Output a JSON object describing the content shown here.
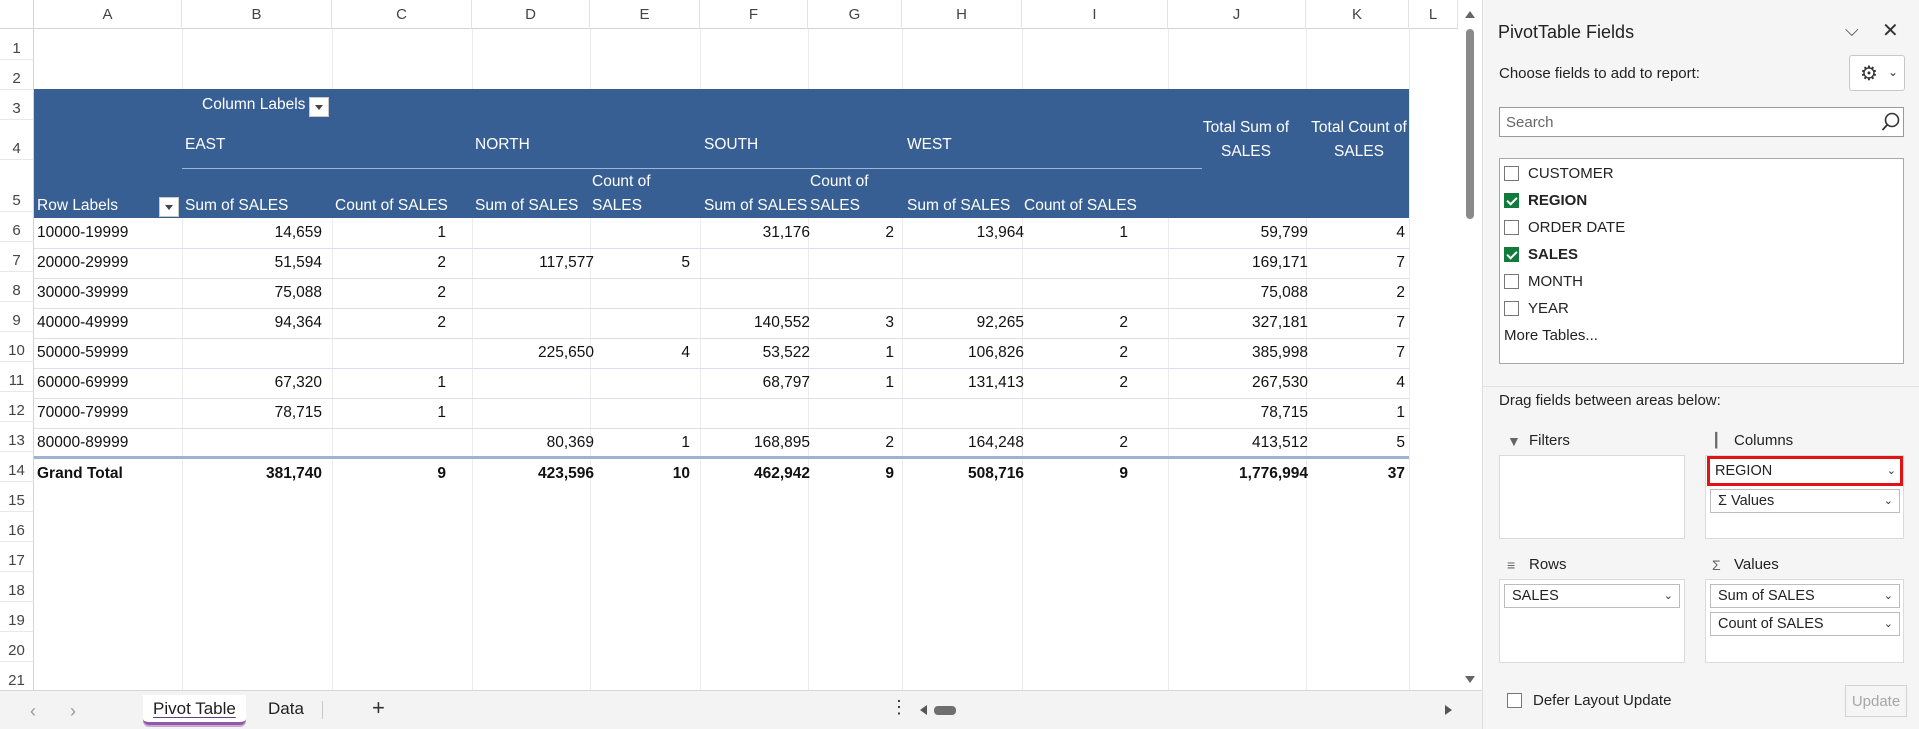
{
  "grid": {
    "columns": [
      "A",
      "B",
      "C",
      "D",
      "E",
      "F",
      "G",
      "H",
      "I",
      "J",
      "K",
      "L"
    ],
    "rows": [
      "1",
      "2",
      "3",
      "4",
      "5",
      "6",
      "7",
      "8",
      "9",
      "10",
      "11",
      "12",
      "13",
      "14",
      "15",
      "16",
      "17",
      "18",
      "19",
      "20",
      "21"
    ]
  },
  "pivot": {
    "column_labels": "Column Labels",
    "row_labels": "Row Labels",
    "regions": [
      "EAST",
      "NORTH",
      "SOUTH",
      "WEST"
    ],
    "sum_label": "Sum of SALES",
    "count_label": "Count of SALES",
    "count_wrapped_1": "Count of",
    "count_wrapped_2": "SALES",
    "total_sum_label": "Total Sum of SALES",
    "total_count_label": "Total Count of SALES",
    "data_rows": [
      {
        "label": "10000-19999",
        "east_sum": "14,659",
        "east_count": "1",
        "north_sum": "",
        "north_count": "",
        "south_sum": "31,176",
        "south_count": "2",
        "west_sum": "13,964",
        "west_count": "1",
        "total_sum": "59,799",
        "total_count": "4"
      },
      {
        "label": "20000-29999",
        "east_sum": "51,594",
        "east_count": "2",
        "north_sum": "117,577",
        "north_count": "5",
        "south_sum": "",
        "south_count": "",
        "west_sum": "",
        "west_count": "",
        "total_sum": "169,171",
        "total_count": "7"
      },
      {
        "label": "30000-39999",
        "east_sum": "75,088",
        "east_count": "2",
        "north_sum": "",
        "north_count": "",
        "south_sum": "",
        "south_count": "",
        "west_sum": "",
        "west_count": "",
        "total_sum": "75,088",
        "total_count": "2"
      },
      {
        "label": "40000-49999",
        "east_sum": "94,364",
        "east_count": "2",
        "north_sum": "",
        "north_count": "",
        "south_sum": "140,552",
        "south_count": "3",
        "west_sum": "92,265",
        "west_count": "2",
        "total_sum": "327,181",
        "total_count": "7"
      },
      {
        "label": "50000-59999",
        "east_sum": "",
        "east_count": "",
        "north_sum": "225,650",
        "north_count": "4",
        "south_sum": "53,522",
        "south_count": "1",
        "west_sum": "106,826",
        "west_count": "2",
        "total_sum": "385,998",
        "total_count": "7"
      },
      {
        "label": "60000-69999",
        "east_sum": "67,320",
        "east_count": "1",
        "north_sum": "",
        "north_count": "",
        "south_sum": "68,797",
        "south_count": "1",
        "west_sum": "131,413",
        "west_count": "2",
        "total_sum": "267,530",
        "total_count": "4"
      },
      {
        "label": "70000-79999",
        "east_sum": "78,715",
        "east_count": "1",
        "north_sum": "",
        "north_count": "",
        "south_sum": "",
        "south_count": "",
        "west_sum": "",
        "west_count": "",
        "total_sum": "78,715",
        "total_count": "1"
      },
      {
        "label": "80000-89999",
        "east_sum": "",
        "east_count": "",
        "north_sum": "80,369",
        "north_count": "1",
        "south_sum": "168,895",
        "south_count": "2",
        "west_sum": "164,248",
        "west_count": "2",
        "total_sum": "413,512",
        "total_count": "5"
      }
    ],
    "grand_total": {
      "label": "Grand Total",
      "east_sum": "381,740",
      "east_count": "9",
      "north_sum": "423,596",
      "north_count": "10",
      "south_sum": "462,942",
      "south_count": "9",
      "west_sum": "508,716",
      "west_count": "9",
      "total_sum": "1,776,994",
      "total_count": "37"
    }
  },
  "sheets": {
    "tabs": [
      "Pivot Table",
      "Data"
    ],
    "active": "Pivot Table"
  },
  "panel": {
    "title": "PivotTable Fields",
    "choose_label": "Choose fields to add to report:",
    "search_placeholder": "Search",
    "fields": [
      {
        "name": "CUSTOMER",
        "checked": false
      },
      {
        "name": "REGION",
        "checked": true
      },
      {
        "name": "ORDER DATE",
        "checked": false
      },
      {
        "name": "SALES",
        "checked": true
      },
      {
        "name": "MONTH",
        "checked": false
      },
      {
        "name": "YEAR",
        "checked": false
      }
    ],
    "more_tables": "More Tables...",
    "drag_label": "Drag fields between areas below:",
    "areas": {
      "filters": "Filters",
      "columns": "Columns",
      "rows": "Rows",
      "values": "Values"
    },
    "columns_items": [
      "REGION",
      "Σ Values"
    ],
    "rows_items": [
      "SALES"
    ],
    "values_items": [
      "Sum of SALES",
      "Count of SALES"
    ],
    "defer_label": "Defer Layout Update",
    "update_label": "Update"
  },
  "colors": {
    "pivot_header": "#385f93",
    "highlight": "#e01414",
    "check": "#117a3c"
  }
}
